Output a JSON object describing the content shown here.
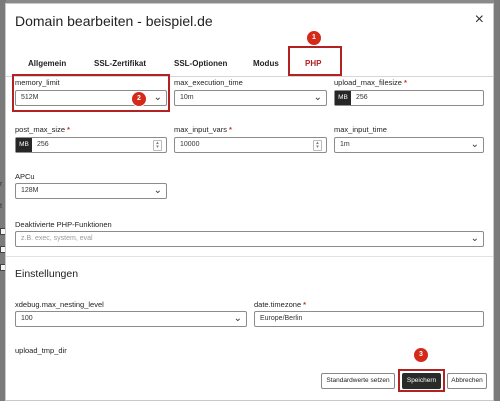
{
  "background": {
    "snip1": "r",
    "snip2": "t"
  },
  "dialog": {
    "title": "Domain bearbeiten - beispiel.de",
    "close": "×"
  },
  "tabs": [
    {
      "label": "Allgemein"
    },
    {
      "label": "SSL-Zertifikat"
    },
    {
      "label": "SSL-Optionen"
    },
    {
      "label": "Modus"
    },
    {
      "label": "PHP"
    }
  ],
  "active_tab": "PHP",
  "annotations": [
    "1",
    "2",
    "3"
  ],
  "fields": {
    "memory_limit": {
      "label": "memory_limit",
      "value": "512M"
    },
    "max_execution_time": {
      "label": "max_execution_time",
      "value": "10m"
    },
    "upload_max_filesize": {
      "label": "upload_max_filesize",
      "unit": "MB",
      "value": "256",
      "required": "*"
    },
    "post_max_size": {
      "label": "post_max_size",
      "unit": "MB",
      "value": "256",
      "required": "*"
    },
    "max_input_vars": {
      "label": "max_input_vars",
      "value": "10000",
      "required": "*"
    },
    "max_input_time": {
      "label": "max_input_time",
      "value": "1m"
    },
    "apcu": {
      "label": "APCu",
      "value": "128M"
    },
    "disabled_functions": {
      "label": "Deaktivierte PHP-Funktionen",
      "placeholder": "z.B. exec, system, eval"
    },
    "xdebug_nesting": {
      "label": "xdebug.max_nesting_level",
      "value": "100"
    },
    "timezone": {
      "label": "date.timezone",
      "value": "Europe/Berlin",
      "required": "*"
    },
    "upload_tmp_dir": {
      "label": "upload_tmp_dir"
    }
  },
  "sections": {
    "settings": "Einstellungen"
  },
  "buttons": {
    "defaults": "Standardwerte setzen",
    "save": "Speichern",
    "cancel": "Abbrechen"
  },
  "icons": {
    "chevron": "chevron-down-icon",
    "spinner": "spinner-arrows-icon"
  },
  "colors": {
    "accent": "#b31f1f",
    "badge": "#d42a1a",
    "highlight": "#b22222",
    "dark": "#262626"
  }
}
